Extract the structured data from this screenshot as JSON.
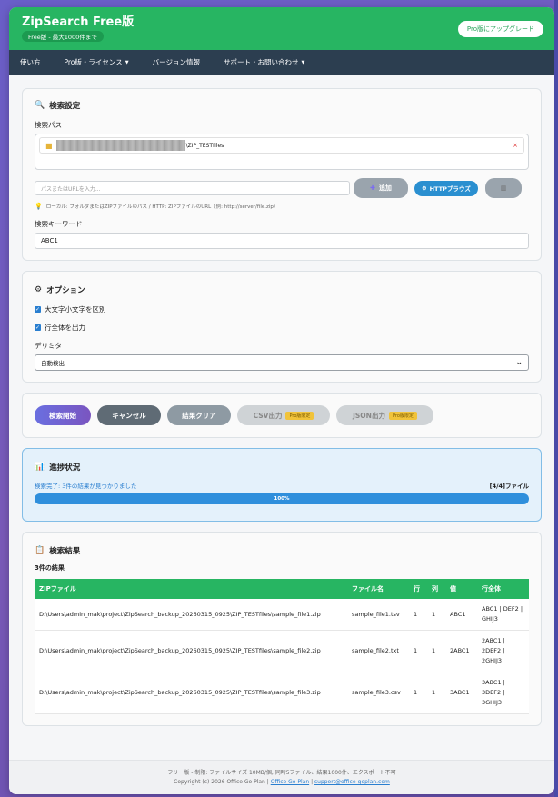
{
  "header": {
    "title": "ZipSearch Free版",
    "badge": "Free版 - 最大1000件まで",
    "upgrade_label": "Pro版にアップグレード"
  },
  "nav": {
    "items": [
      "使い方",
      "Pro版・ライセンス",
      "バージョン情報",
      "サポート・お問い合わせ"
    ]
  },
  "search_settings": {
    "title": "検索設定",
    "path_label": "検索パス",
    "path_item_suffix": "\\ZIP_TESTfiles",
    "path_input_placeholder": "パスまたはURLを入力...",
    "add_label": "追加",
    "http_label": "HTTPブラウズ",
    "hint": "ローカル: フォルダまたはZIPファイルのパス / HTTP: ZIPファイルのURL（例: http://server/file.zip）",
    "keyword_label": "検索キーワード",
    "keyword_value": "ABC1"
  },
  "options": {
    "title": "オプション",
    "case_label": "大文字小文字を区別",
    "case_checked": true,
    "full_line_label": "行全体を出力",
    "full_line_checked": true,
    "delimiter_label": "デリミタ",
    "delimiter_value": "自動検出"
  },
  "actions": {
    "start": "検索開始",
    "cancel": "キャンセル",
    "clear": "結果クリア",
    "csv": "CSV出力",
    "json": "JSON出力",
    "pro_tag": "Pro版限定"
  },
  "status": {
    "title": "進捗状況",
    "message": "検索完了: 3件の結果が見つかりました",
    "count": "[4/4]ファイル",
    "progress_label": "100%",
    "progress": 1.0
  },
  "results": {
    "title": "検索結果",
    "count_label": "3件の結果",
    "columns": [
      "ZIPファイル",
      "ファイル名",
      "行",
      "列",
      "値",
      "行全体"
    ],
    "rows": [
      [
        "D:\\Users\\admin_mak\\project\\ZipSearch_backup_20260315_0925\\ZIP_TESTfiles\\sample_file1.zip",
        "sample_file1.tsv",
        "1",
        "1",
        "ABC1",
        "ABC1 | DEF2 | GHIJ3"
      ],
      [
        "D:\\Users\\admin_mak\\project\\ZipSearch_backup_20260315_0925\\ZIP_TESTfiles\\sample_file2.zip",
        "sample_file2.txt",
        "1",
        "1",
        "2ABC1",
        "2ABC1 | 2DEF2 | 2GHIJ3"
      ],
      [
        "D:\\Users\\admin_mak\\project\\ZipSearch_backup_20260315_0925\\ZIP_TESTfiles\\sample_file3.zip",
        "sample_file3.csv",
        "1",
        "1",
        "3ABC1",
        "3ABC1 | 3DEF2 | 3GHIJ3"
      ]
    ]
  },
  "footer": {
    "line1": "フリー版 - 制限: ファイルサイズ 10MB/個, 同時5ファイル、結果1000件、エクスポート不可",
    "copyright": "Copyright (c) 2026 Office Go Plan |",
    "link1": "Office Go Plan",
    "sep": "|",
    "link2": "support@office-goplan.com"
  },
  "colors": {
    "brand_green": "#27b562",
    "nav_dark": "#2c3e50",
    "accent_blue": "#2a8fd0"
  }
}
